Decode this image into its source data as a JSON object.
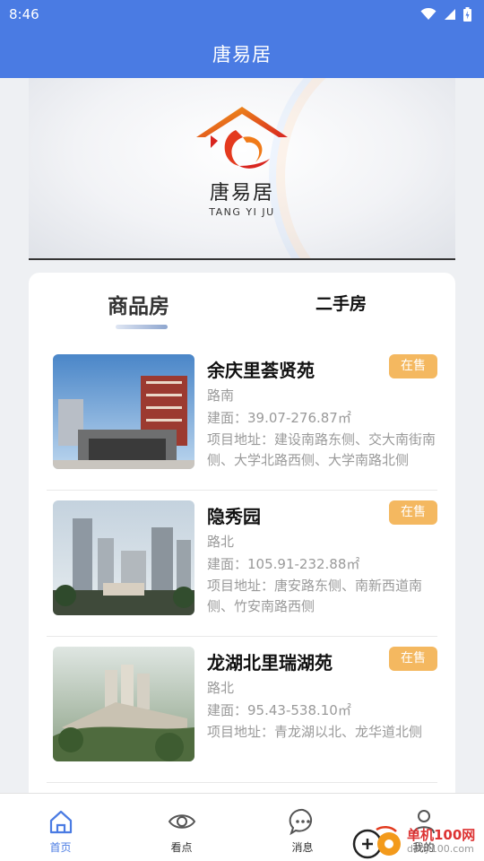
{
  "status": {
    "time": "8:46"
  },
  "header": {
    "title": "唐易居"
  },
  "banner": {
    "logo_cn": "唐易居",
    "logo_en": "TANG YI JU"
  },
  "tabs": [
    {
      "label": "商品房",
      "active": true
    },
    {
      "label": "二手房",
      "active": false
    }
  ],
  "listings": [
    {
      "name": "余庆里荟贤苑",
      "status": "在售",
      "road": "路南",
      "area": "建面：39.07-276.87㎡",
      "address": "项目地址：建设南路东侧、交大南街南侧、大学北路西侧、大学南路北侧"
    },
    {
      "name": "隐秀园",
      "status": "在售",
      "road": "路北",
      "area": "建面：105.91-232.88㎡",
      "address": "项目地址：唐安路东侧、南新西道南侧、竹安南路西侧"
    },
    {
      "name": "龙湖北里瑞湖苑",
      "status": "在售",
      "road": "路北",
      "area": "建面：95.43-538.10㎡",
      "address": "项目地址：青龙湖以北、龙华道北侧"
    }
  ],
  "bottom_nav": [
    {
      "label": "首页",
      "icon": "home-icon",
      "active": true
    },
    {
      "label": "看点",
      "icon": "eye-icon",
      "active": false
    },
    {
      "label": "消息",
      "icon": "chat-icon",
      "active": false
    },
    {
      "label": "我的",
      "icon": "user-icon",
      "active": false
    }
  ],
  "watermark": {
    "brand": "单机100网",
    "url": "danji100.com"
  },
  "colors": {
    "primary": "#4a7be3",
    "tag": "#f4b860",
    "text_muted": "#9a9a9a"
  }
}
